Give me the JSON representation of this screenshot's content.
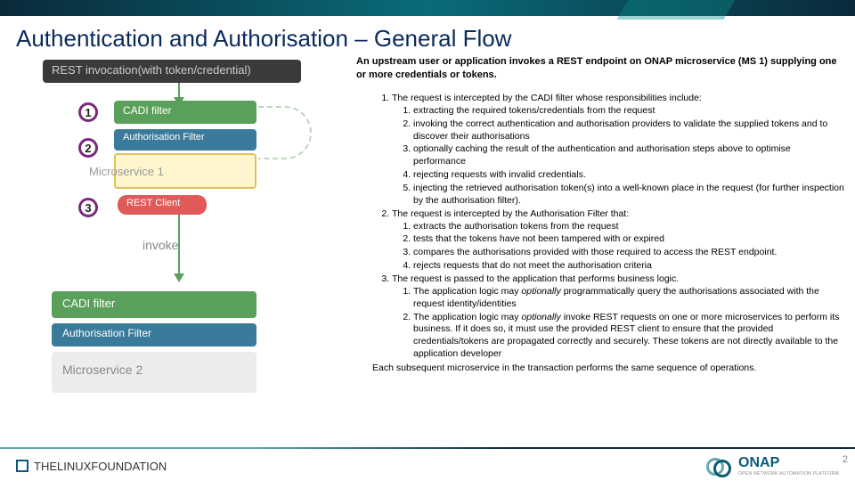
{
  "title": "Authentication and Authorisation – General Flow",
  "intro": "An upstream user or application invokes a REST endpoint on ONAP microservice (MS 1) supplying one or more credentials or tokens.",
  "diagram": {
    "rest_invocation": "REST invocation(with token/credential)",
    "cadi_filter": "CADI filter",
    "auth_filter": "Authorisation Filter",
    "ms1": "Microservice 1",
    "rest_client": "REST Client",
    "invoke": "invoke",
    "ms2": "Microservice 2",
    "num1": "1",
    "num2": "2",
    "num3": "3"
  },
  "steps": {
    "s1": "The request is intercepted by the CADI filter whose responsibilities include:",
    "s1_1": "extracting the required tokens/credentials from the request",
    "s1_2": "invoking the correct authentication and authorisation providers to validate the supplied tokens and to discover their authorisations",
    "s1_3": "optionally caching the result of the authentication and authorisation steps above to optimise performance",
    "s1_4": "rejecting requests with invalid credentials.",
    "s1_5": "injecting the retrieved authorisation token(s) into a well-known place in the request (for further inspection by the authorisation filter).",
    "s2": "The request is intercepted by the Authorisation Filter that:",
    "s2_1": "extracts the authorisation tokens from the request",
    "s2_2": "tests that the tokens have not been tampered with or expired",
    "s2_3": "compares the authorisations provided with those required to access the REST endpoint.",
    "s2_4": "rejects requests that do not meet the authorisation criteria",
    "s3": "The request is passed to the application that performs business logic.",
    "s3_1a": "The application logic may ",
    "s3_1b": " programmatically query the authorisations associated with the request identity/identities",
    "s3_2a": "The application logic may ",
    "s3_2b": " invoke REST requests on one or more microservices to perform its business. If it does so, it must use the provided REST client to ensure that the provided credentials/tokens are propagated correctly and securely. These tokens are not directly available to the application developer",
    "optionally": "optionally",
    "closing": "Each subsequent microservice in the transaction performs the same sequence of operations."
  },
  "footer": {
    "linux": "THELINUXFOUNDATION",
    "onap": "ONAP",
    "onap_sub": "OPEN NETWORK AUTOMATION PLATFORM",
    "page": "2"
  }
}
